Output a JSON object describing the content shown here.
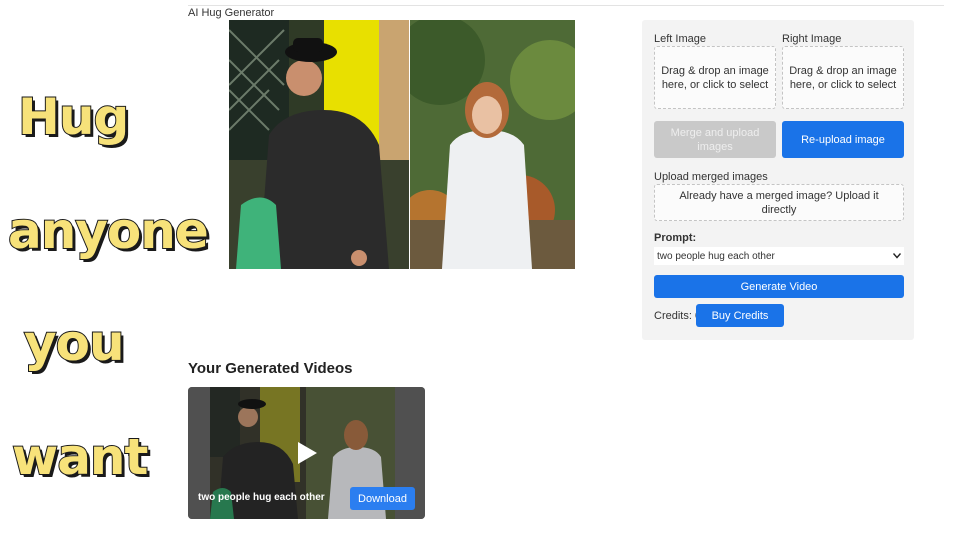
{
  "overlay_text": [
    "Hug",
    "anyone",
    "you",
    "want"
  ],
  "app": {
    "title": "AI Hug Generator"
  },
  "uploader": {
    "left_label": "Left Image",
    "right_label": "Right Image",
    "left_drop": "Drag & drop an image here, or click to select",
    "right_drop": "Drag & drop an image here, or click to select",
    "merge_button": "Merge and upload images",
    "reupload_button": "Re-upload image",
    "merged_label": "Upload merged images",
    "merged_drop": "Already have a merged image? Upload it directly",
    "prompt_label": "Prompt:",
    "prompt_value": "two people hug each other",
    "generate_button": "Generate Video",
    "credits_label": "Credits: 0",
    "buy_button": "Buy Credits"
  },
  "videos": {
    "title": "Your Generated Videos",
    "items": [
      {
        "caption": "two people hug each other",
        "download_label": "Download"
      }
    ]
  },
  "colors": {
    "primary": "#1a73e8",
    "overlay_text": "#f7e27a",
    "disabled": "#c9c9c9",
    "panel_bg": "#f3f3f3"
  }
}
